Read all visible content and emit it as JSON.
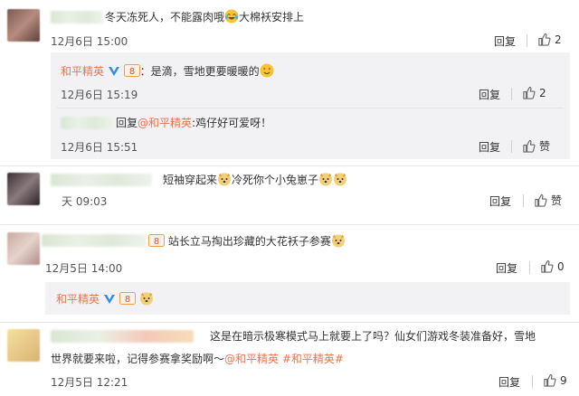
{
  "comments": [
    {
      "text": "冬天冻死人，不能露肉哦",
      "text_tail": "大棉袄安排上",
      "time": "12月6日 15:00",
      "reply_label": "回复",
      "like_count": "2",
      "subs": [
        {
          "author": "和平精英",
          "text": "：是滴，雪地更要暖暖的",
          "time": "12月6日 15:19",
          "reply_label": "回复",
          "like_count": "2"
        },
        {
          "reply_prefix": "回复",
          "mention": "@和平精英",
          "text": ":鸡仔好可爱呀！",
          "time": "12月6日 15:51",
          "reply_label": "回复",
          "like_label": "赞"
        }
      ]
    },
    {
      "text": "短袖穿起来",
      "text_tail": "冷死你个小兔崽子",
      "time": "天 09:03",
      "reply_label": "回复",
      "like_label": "赞"
    },
    {
      "text": "站长立马掏出珍藏的大花袄子参赛",
      "time": "12月5日 14:00",
      "reply_label": "回复",
      "like_count": "0",
      "subs": [
        {
          "author": "和平精英"
        }
      ]
    },
    {
      "text_line1": "这是在暗示极寒模式马上就要上了吗？仙女们游戏冬装准备好，雪地",
      "text_line2": "世界就要来啦，记得参赛拿奖励啊～",
      "mention": "@和平精英",
      "hashtag": "#和平精英#",
      "time": "12月5日 12:21",
      "reply_label": "回复",
      "like_count": "9"
    }
  ],
  "colors": {
    "accent": "#eb7350",
    "sub_bg": "#f2f2f5",
    "vip_blue": "#2f8de4"
  },
  "icons": [
    "thumb-up-icon",
    "laugh-cry-emoji",
    "dog-emoji",
    "verified-icon",
    "vip-badge-icon",
    "heart-eyes-emoji"
  ]
}
